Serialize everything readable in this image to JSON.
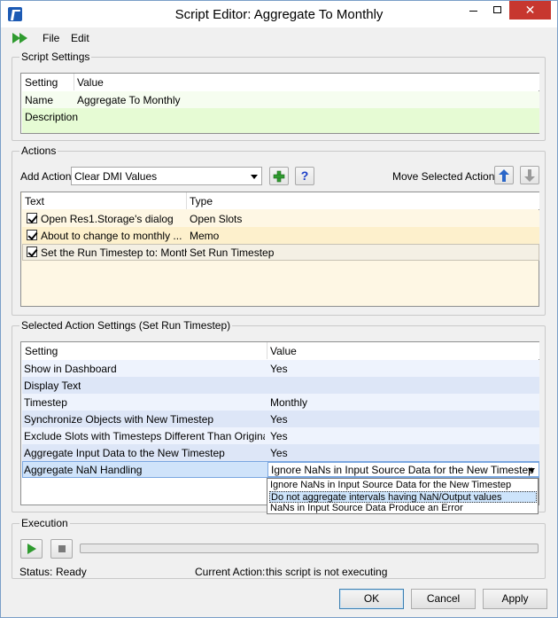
{
  "window": {
    "title": "Script Editor: Aggregate To Monthly"
  },
  "menu": {
    "file": "File",
    "edit": "Edit"
  },
  "script_settings": {
    "group_label": "Script Settings",
    "headers": [
      "Setting",
      "Value"
    ],
    "rows": [
      {
        "setting": "Name",
        "value": "Aggregate To Monthly"
      },
      {
        "setting": "Description",
        "value": ""
      }
    ]
  },
  "actions": {
    "group_label": "Actions",
    "add_action_label": "Add Action",
    "add_action_value": "Clear DMI Values",
    "move_label": "Move Selected Action:",
    "headers": [
      "Text",
      "Type"
    ],
    "rows": [
      {
        "text": "Open Res1.Storage's dialog",
        "type": "Open Slots",
        "checked": true
      },
      {
        "text": "About to change to monthly ...",
        "type": "Memo",
        "checked": true
      },
      {
        "text": "Set the Run Timestep to: Monthly",
        "type": "Set Run Timestep",
        "checked": true
      }
    ]
  },
  "selected_action": {
    "group_label": "Selected Action Settings (Set Run Timestep)",
    "headers": [
      "Setting",
      "Value"
    ],
    "rows": [
      {
        "setting": "Show in Dashboard",
        "value": "Yes"
      },
      {
        "setting": "Display Text",
        "value": ""
      },
      {
        "setting": "Timestep",
        "value": "Monthly"
      },
      {
        "setting": "Synchronize Objects with New Timestep",
        "value": "Yes"
      },
      {
        "setting": "Exclude Slots with Timesteps Different Than Original Run",
        "value": "Yes"
      },
      {
        "setting": "Aggregate Input Data to the New Timestep",
        "value": "Yes"
      },
      {
        "setting": "Aggregate NaN Handling",
        "value": "Ignore NaNs in Input Source Data for the New Timestep"
      }
    ],
    "dropdown_options": [
      "Ignore NaNs in Input Source Data for the New Timestep",
      "Do not aggregate intervals having NaN/Output values",
      "NaNs in Input Source Data Produce an Error"
    ],
    "dropdown_highlighted": "Do not aggregate intervals having NaN/Output values"
  },
  "execution": {
    "group_label": "Execution",
    "status_label": "Status:",
    "status_value": "Ready",
    "current_action_label": "Current Action:",
    "current_action_value": "this script is not executing",
    "progress": 0
  },
  "buttons": {
    "ok": "OK",
    "cancel": "Cancel",
    "apply": "Apply"
  },
  "colors": {
    "accent_blue": "#1c5ab4",
    "run_green": "#2f9b2f",
    "settings_row": "#f6fdf0",
    "settings_row_alt": "#e6fbd4",
    "actions_bg": "#fef7e4",
    "actions_row_alt": "#fdf0cc",
    "sel_row": "#eef3fd",
    "sel_row_alt": "#dde6f7",
    "sel_highlight": "#cfe3fa"
  }
}
